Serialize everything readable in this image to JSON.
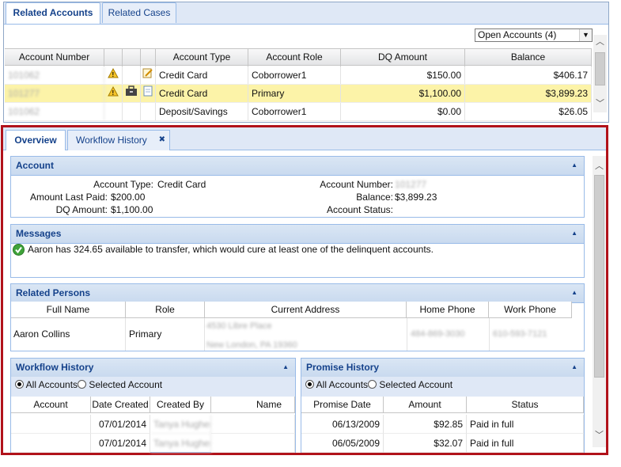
{
  "top_tabs": [
    {
      "label": "Related Accounts",
      "active": true
    },
    {
      "label": "Related Cases",
      "active": false
    }
  ],
  "filter": {
    "value": "Open Accounts (4)"
  },
  "accounts_grid": {
    "columns": [
      "Account Number",
      "",
      "",
      "",
      "Account Type",
      "Account Role",
      "DQ Amount",
      "Balance"
    ],
    "rows": [
      {
        "number": "101062",
        "warn": true,
        "brief": false,
        "doc": "edit",
        "type": "Credit Card",
        "role": "Coborrower1",
        "dq": "$150.00",
        "balance": "$406.17",
        "highlight": false
      },
      {
        "number": "101277",
        "warn": true,
        "brief": true,
        "doc": "page",
        "type": "Credit Card",
        "role": "Primary",
        "dq": "$1,100.00",
        "balance": "$3,899.23",
        "highlight": true
      },
      {
        "number": "101062",
        "warn": false,
        "brief": false,
        "doc": "",
        "type": "Deposit/Savings",
        "role": "Coborrower1",
        "dq": "$0.00",
        "balance": "$26.05",
        "highlight": false
      }
    ]
  },
  "lower_tabs": [
    {
      "label": "Overview",
      "active": true
    },
    {
      "label": "Workflow History",
      "active": false,
      "close": "✖"
    }
  ],
  "account_panel": {
    "title": "Account",
    "account_type_label": "Account Type:",
    "account_type": "Credit Card",
    "amount_last_paid_label": "Amount Last Paid:",
    "amount_last_paid": "$200.00",
    "dq_amount_label": "DQ Amount:",
    "dq_amount": "$1,100.00",
    "account_number_label": "Account Number:",
    "account_number": "101277",
    "balance_label": "Balance:",
    "balance": "$3,899.23",
    "account_status_label": "Account Status:",
    "account_status": ""
  },
  "messages_panel": {
    "title": "Messages",
    "message": "Aaron has 324.65 available to transfer, which would cure at least one of the delinquent accounts."
  },
  "persons_panel": {
    "title": "Related Persons",
    "columns": [
      "Full Name",
      "Role",
      "Current Address",
      "Home Phone",
      "Work Phone"
    ],
    "rows": [
      {
        "name": "Aaron Collins",
        "role": "Primary",
        "address1": "4530 Libre Place",
        "address2": "New London, PA 19360",
        "home": "484-869-3030",
        "work": "610-593-7121"
      }
    ]
  },
  "workflow_panel": {
    "title": "Workflow History",
    "radio_all": "All Accounts",
    "radio_selected": "Selected Account",
    "columns": [
      "Account",
      "Date Created",
      "Created By",
      "Name"
    ],
    "rows": [
      {
        "account": "",
        "date": "07/01/2014",
        "by": "Tanya Hughes",
        "name": ""
      },
      {
        "account": "",
        "date": "07/01/2014",
        "by": "Tanya Hughes",
        "name": ""
      }
    ]
  },
  "promise_panel": {
    "title": "Promise History",
    "radio_all": "All Accounts",
    "radio_selected": "Selected Account",
    "columns": [
      "Promise Date",
      "Amount",
      "Status"
    ],
    "rows": [
      {
        "date": "06/13/2009",
        "amount": "$92.85",
        "status": "Paid in full"
      },
      {
        "date": "06/05/2009",
        "amount": "$32.07",
        "status": "Paid in full"
      }
    ]
  },
  "colors": {
    "accent": "#15428b",
    "frame": "#b1121a",
    "highlight": "#fcf3a8"
  }
}
